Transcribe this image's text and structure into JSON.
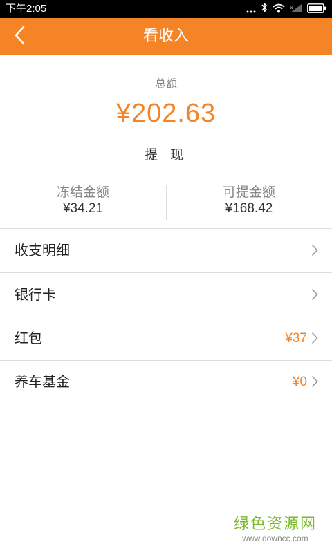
{
  "status_bar": {
    "time": "下午2:05",
    "icons": [
      "bluetooth-icon",
      "wifi-icon",
      "signal-icon",
      "battery-icon"
    ]
  },
  "header": {
    "back_icon": "chevron-left-icon",
    "title": "看收入",
    "background_color": "#f58426"
  },
  "summary": {
    "total_label": "总额",
    "total_amount": "¥202.63",
    "withdraw_label": "提 现",
    "amount_color": "#f58426"
  },
  "balances": [
    {
      "label": "冻结金额",
      "value": "¥34.21"
    },
    {
      "label": "可提金额",
      "value": "¥168.42"
    }
  ],
  "menu": [
    {
      "label": "收支明细",
      "value": "",
      "icon": "chevron-right-icon"
    },
    {
      "label": "银行卡",
      "value": "",
      "icon": "chevron-right-icon"
    },
    {
      "label": "红包",
      "value": "¥37",
      "icon": "chevron-right-icon"
    },
    {
      "label": "养车基金",
      "value": "¥0",
      "icon": "chevron-right-icon"
    }
  ],
  "watermark": {
    "title": "绿色资源网",
    "url": "www.downcc.com"
  }
}
